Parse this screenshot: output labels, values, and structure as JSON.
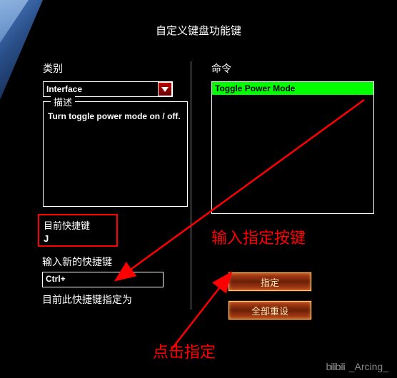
{
  "dialog": {
    "title": "自定义键盘功能键"
  },
  "category": {
    "label": "类别",
    "value": "Interface"
  },
  "description": {
    "legend": "描述",
    "text": "Turn toggle power mode on / off."
  },
  "command": {
    "label": "命令",
    "selected": "Toggle Power Mode"
  },
  "current_key": {
    "label": "目前快捷键",
    "value": "J"
  },
  "new_key": {
    "label": "输入新的快捷键",
    "value": "Ctrl+"
  },
  "assigned": {
    "label": "目前此快捷键指定为"
  },
  "buttons": {
    "assign": "指定",
    "reset_all": "全部重设"
  },
  "annotations": {
    "input_key": "输入指定按键",
    "click_assign": "点击指定"
  },
  "watermark": {
    "logo": "bilibili",
    "user": "_Arcing_"
  }
}
